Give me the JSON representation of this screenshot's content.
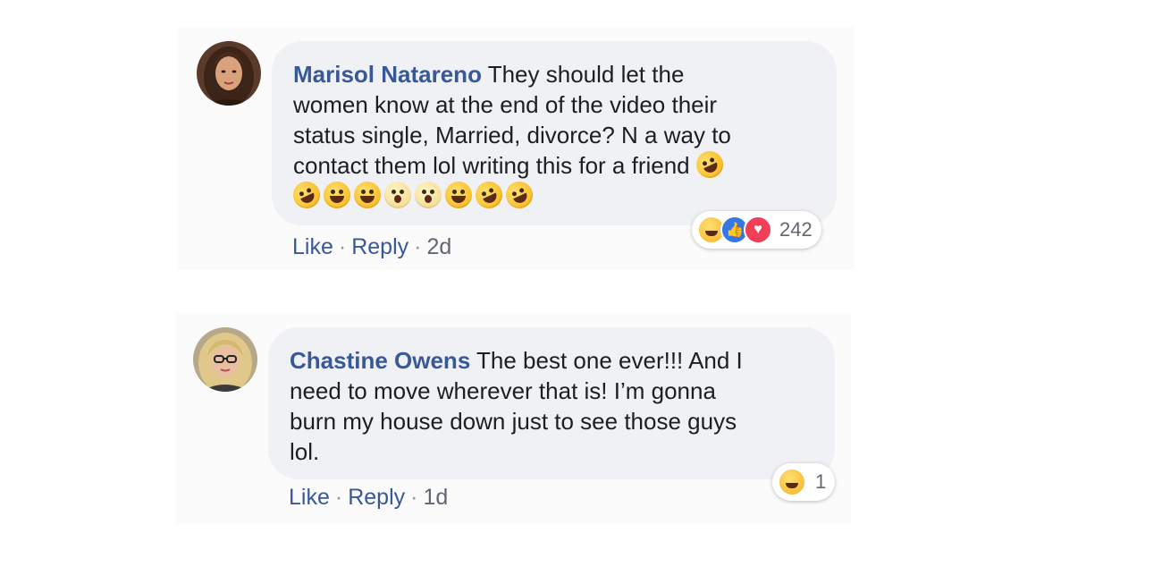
{
  "comments": [
    {
      "author": "Marisol Natareno",
      "text_lines": [
        " They should let the",
        "women know at the end of the video their",
        "status single, Married, divorce? N a way to",
        "contact them lol writing this for a friend"
      ],
      "emoji_line": [
        "rofl",
        "sweat-smile",
        "grin",
        "scream",
        "scream",
        "grin",
        "rofl",
        "rofl"
      ],
      "like_label": "Like",
      "reply_label": "Reply",
      "separator": "·",
      "time": "2d",
      "reactions": [
        "haha",
        "like",
        "love"
      ],
      "reaction_count": "242"
    },
    {
      "author": "Chastine Owens",
      "text_lines": [
        " The best one ever!!! And I",
        "need to move wherever that is! I’m gonna",
        "burn my house down just to see those guys",
        "lol."
      ],
      "like_label": "Like",
      "reply_label": "Reply",
      "separator": "·",
      "time": "1d",
      "reactions": [
        "haha"
      ],
      "reaction_count": "1"
    }
  ],
  "colors": {
    "author": "#385898",
    "bubble": "#f0f1f4",
    "text": "#1c1e21",
    "meta": "#606770"
  }
}
